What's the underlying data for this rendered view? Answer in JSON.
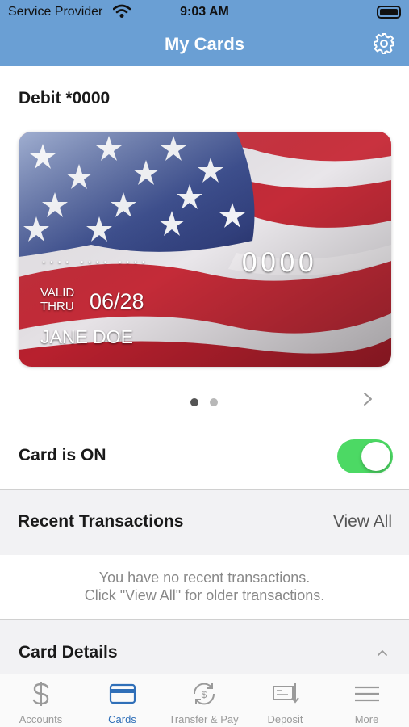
{
  "status_bar": {
    "carrier": "Service Provider",
    "time": "9:03 AM"
  },
  "header": {
    "title": "My Cards",
    "settings_icon": "gear-icon"
  },
  "card": {
    "name": "Debit *0000",
    "number_mask": "···· ···· ····",
    "number_last": "0000",
    "valid_line1": "VALID",
    "valid_line2": "THRU",
    "expiry": "06/28",
    "holder": "JANE DOE",
    "design": "american-flag"
  },
  "pager": {
    "count": 2,
    "active_index": 0
  },
  "card_toggle": {
    "label": "Card is ON",
    "on": true,
    "color": "#4cd964"
  },
  "recent_transactions": {
    "title": "Recent Transactions",
    "view_all": "View All",
    "empty_line1": "You have no recent transactions.",
    "empty_line2": "Click \"View All\" for older transactions."
  },
  "card_details": {
    "title": "Card Details"
  },
  "tabs": [
    {
      "label": "Accounts",
      "icon": "dollar-icon",
      "active": false
    },
    {
      "label": "Cards",
      "icon": "card-icon",
      "active": true
    },
    {
      "label": "Transfer & Pay",
      "icon": "transfer-icon",
      "active": false
    },
    {
      "label": "Deposit",
      "icon": "check-deposit-icon",
      "active": false
    },
    {
      "label": "More",
      "icon": "menu-icon",
      "active": false
    }
  ],
  "colors": {
    "header_bg": "#6a9fd4",
    "tab_active": "#2f6fb8",
    "tab_inactive": "#9a9a9a"
  }
}
